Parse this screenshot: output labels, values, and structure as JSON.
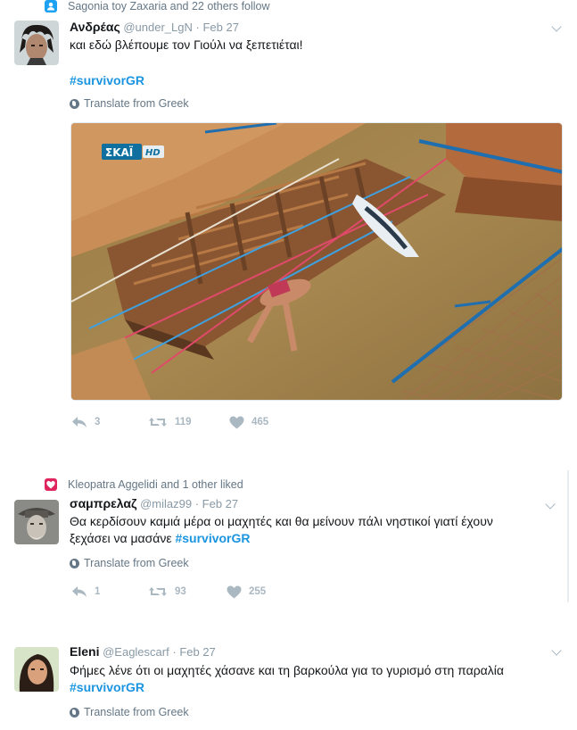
{
  "tweets": [
    {
      "context": "Sagonia toy Zaxaria and 22 others follow",
      "context_icon": "follow-person-icon",
      "context_color": "#1da1f2",
      "fullname": "Ανδρέας",
      "username": "@under_LgN",
      "date": "Feb 27",
      "text": "και εδώ βλέπουμε τον Γιούλι να ξεπετιέται!",
      "hashtag": "#survivorGR",
      "translate": "Translate from Greek",
      "media_watermark": "ΣΚΑΪ",
      "media_watermark_hd": "HD",
      "replies": "3",
      "retweets": "119",
      "likes": "465"
    },
    {
      "context": "Kleopatra Aggelidi and 1 other liked",
      "context_icon": "heart-icon",
      "context_color": "#e0245e",
      "fullname": "σαμπρελαζ",
      "username": "@milaz99",
      "date": "Feb 27",
      "text_line1": "Θα κερδίσουν καμιά μέρα οι μαχητές και θα μείνουν πάλι νηστικοί γιατί έχουν",
      "text_line2": "ξεχάσει να μασάνε",
      "hashtag": "#survivorGR",
      "translate": "Translate from Greek",
      "replies": "1",
      "retweets": "93",
      "likes": "255"
    },
    {
      "fullname": "Eleni",
      "username": "@Eaglescarf",
      "date": "Feb 27",
      "text": "Φήμες λένε ότι οι μαχητές χάσανε και τη βαρκούλα για το γυρισμό στη παραλία",
      "hashtag": "#survivorGR",
      "translate": "Translate from Greek"
    }
  ],
  "separator": "·",
  "colors": {
    "link": "#1b95e0",
    "muted": "#657786",
    "action": "#aab8c2"
  }
}
